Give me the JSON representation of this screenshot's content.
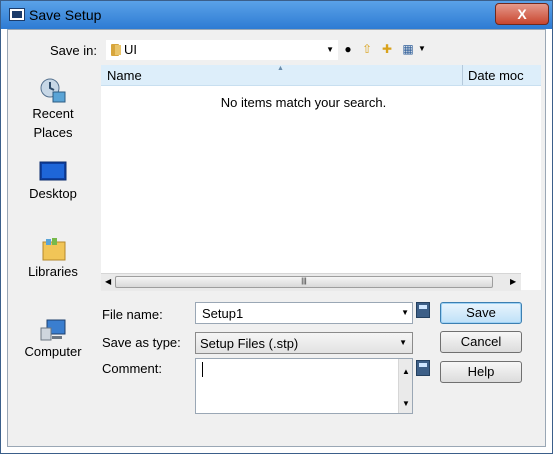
{
  "window": {
    "title": "Save Setup",
    "close_label": "X"
  },
  "toolbar": {
    "save_in_label": "Save in:",
    "save_in_value": "UI"
  },
  "places": [
    {
      "label": "Recent\nPlaces",
      "icon": "recent-places-icon"
    },
    {
      "label": "Desktop",
      "icon": "desktop-icon"
    },
    {
      "label": "Libraries",
      "icon": "libraries-icon"
    },
    {
      "label": "Computer",
      "icon": "computer-icon"
    }
  ],
  "file_list": {
    "columns": [
      "Name",
      "Date moc"
    ],
    "empty_message": "No items match your search."
  },
  "form": {
    "file_name_label": "File name:",
    "file_name_value": "Setup1",
    "save_as_type_label": "Save as type:",
    "save_as_type_value": "Setup Files (.stp)",
    "comment_label": "Comment:",
    "comment_value": ""
  },
  "buttons": {
    "save": "Save",
    "cancel": "Cancel",
    "help": "Help"
  },
  "colors": {
    "title_bar": "#2e7bd3",
    "close_button": "#c9462f",
    "header": "#ddeefa"
  }
}
